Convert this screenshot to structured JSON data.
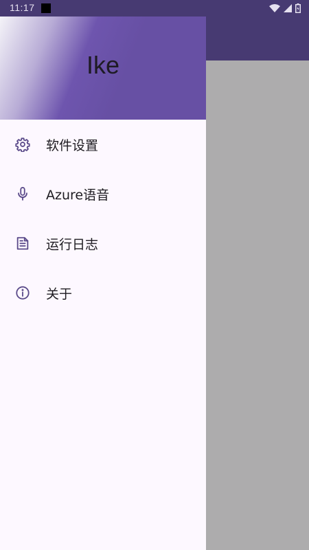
{
  "status_bar": {
    "time": "11:17"
  },
  "drawer": {
    "title": "Ike",
    "items": [
      {
        "label": "软件设置",
        "icon": "gear-icon"
      },
      {
        "label": "Azure语音",
        "icon": "microphone-icon"
      },
      {
        "label": "运行日志",
        "icon": "document-icon"
      },
      {
        "label": "关于",
        "icon": "info-icon"
      }
    ]
  },
  "colors": {
    "accent": "#6750a4",
    "app_bar": "#473a72",
    "drawer_background": "#fdf8ff",
    "scrim": "#adacad",
    "icon": "#5b4b8a"
  }
}
